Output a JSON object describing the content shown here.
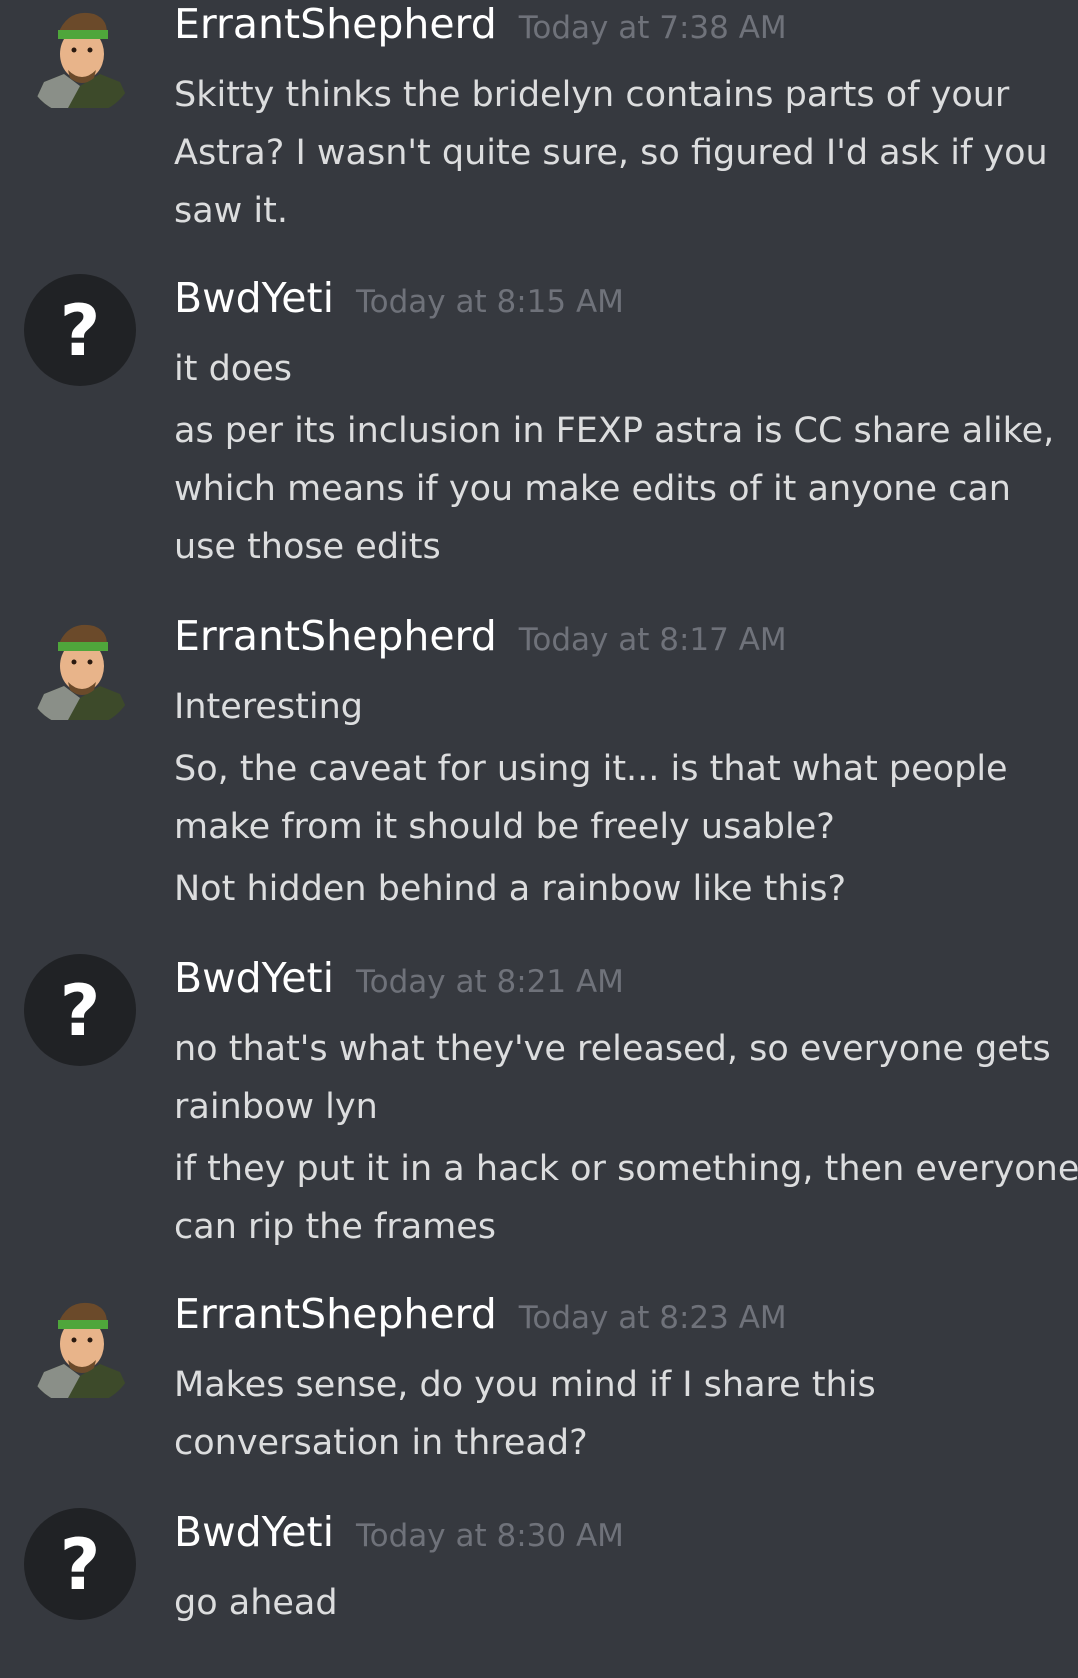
{
  "channel": {
    "messages": [
      {
        "username": "ErrantShepherd",
        "timestamp": "Today at 7:38 AM",
        "avatar": "shepherd-portrait",
        "lines": [
          "Skitty thinks the bridelyn contains parts of your",
          "Astra? I wasn't quite sure, so figured I'd ask if you",
          "saw it."
        ]
      },
      {
        "username": "BwdYeti",
        "timestamp": "Today at 8:15 AM",
        "avatar": "question-mark",
        "lines": [
          "it does",
          "as per its inclusion in FEXP astra is CC share alike,",
          "which means if you make edits of it anyone can",
          "use those edits"
        ]
      },
      {
        "username": "ErrantShepherd",
        "timestamp": "Today at 8:17 AM",
        "avatar": "shepherd-portrait",
        "lines": [
          "Interesting",
          "So, the caveat for using it... is that what people",
          "make from it should be freely usable?",
          "Not hidden behind a rainbow like this?"
        ]
      },
      {
        "username": "BwdYeti",
        "timestamp": "Today at 8:21 AM",
        "avatar": "question-mark",
        "lines": [
          "no that's what they've released, so everyone gets",
          "rainbow lyn",
          "if they put it in a hack or something, then everyone",
          "can rip the frames"
        ]
      },
      {
        "username": "ErrantShepherd",
        "timestamp": "Today at 8:23 AM",
        "avatar": "shepherd-portrait",
        "lines": [
          "Makes sense, do you mind if I share this",
          "conversation in thread?"
        ]
      },
      {
        "username": "BwdYeti",
        "timestamp": "Today at 8:30 AM",
        "avatar": "question-mark",
        "lines": [
          "go ahead"
        ]
      }
    ],
    "question_mark_glyph": "?"
  }
}
